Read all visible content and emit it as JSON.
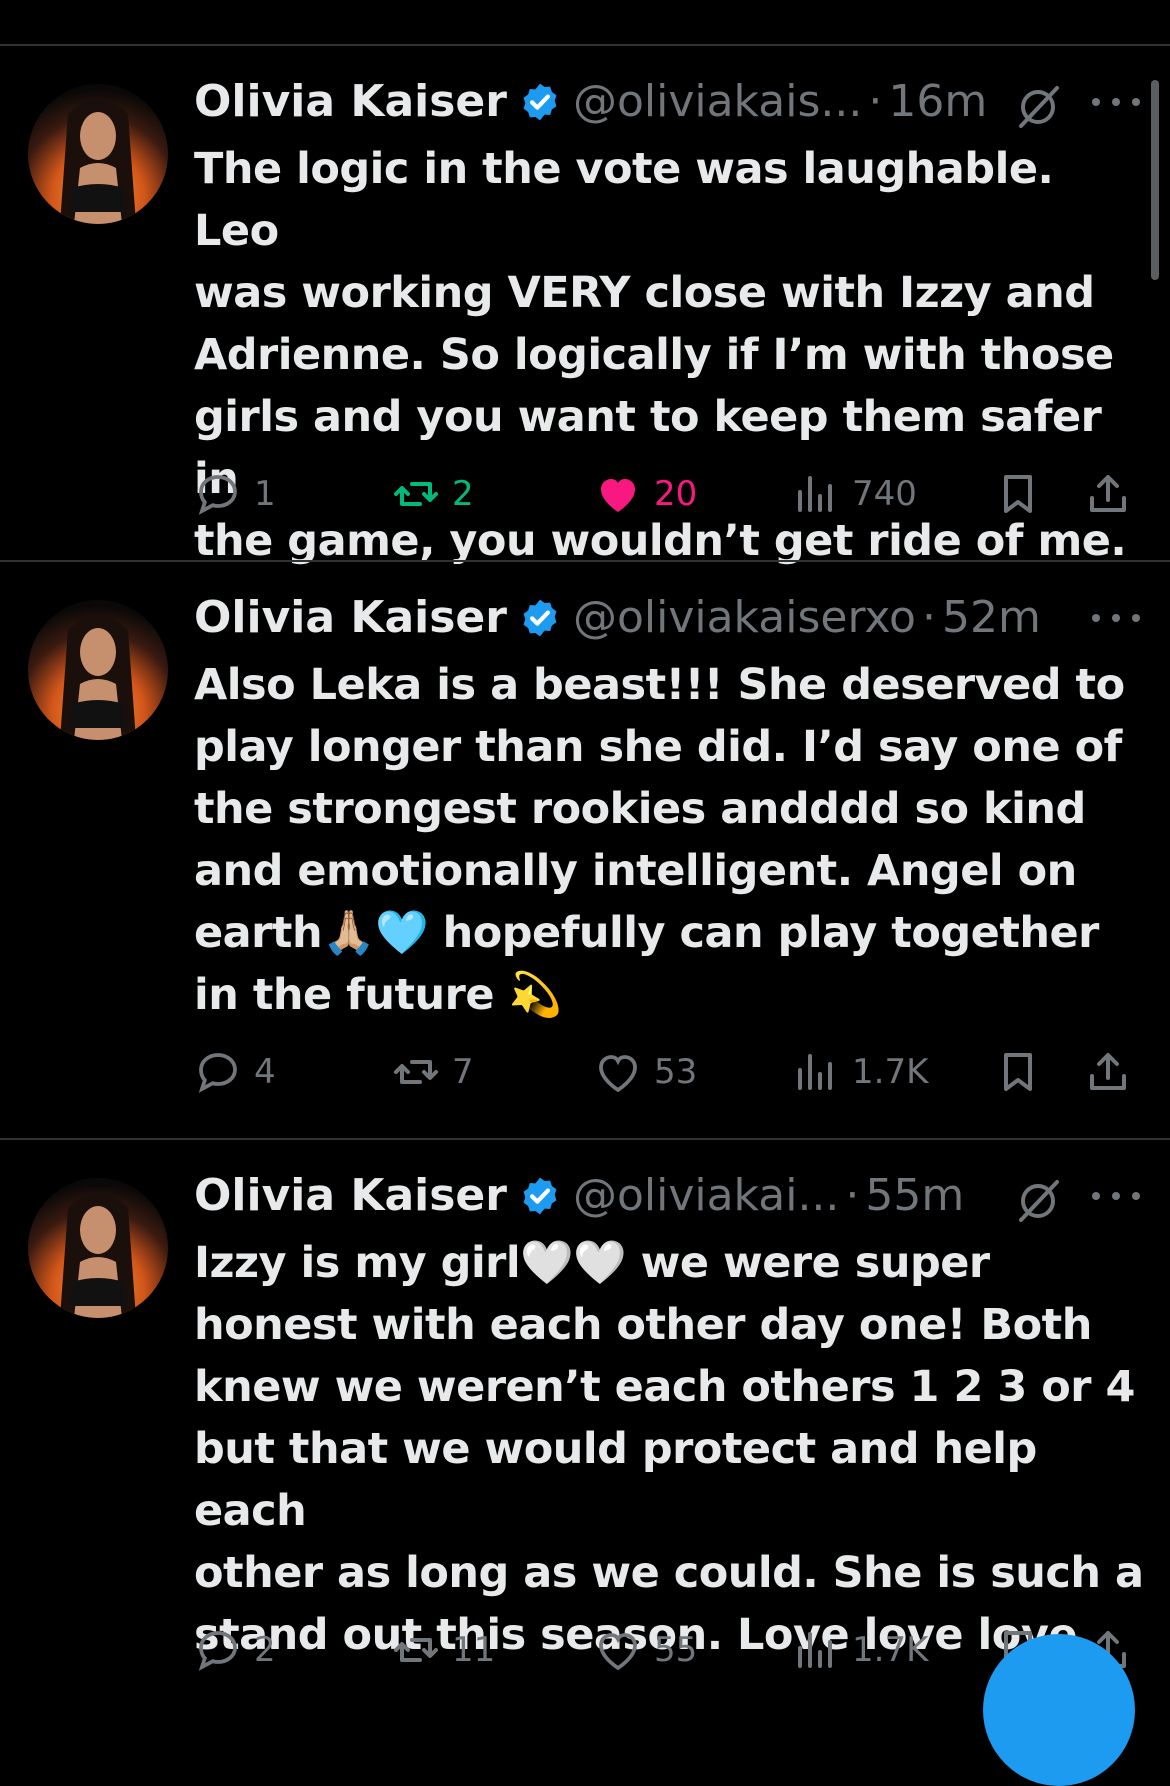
{
  "tweets": [
    {
      "name": "Olivia Kaiser",
      "handle": "@oliviakais...",
      "time": "16m",
      "text": "The logic in the vote was laughable. Leo\nwas working VERY close with Izzy and\nAdrienne. So logically if I’m with those\ngirls and you want to keep them safer in\nthe game, you wouldn’t get ride of me.",
      "replies": "1",
      "retweets": "2",
      "likes": "20",
      "views": "740",
      "retweeted": true,
      "liked": true
    },
    {
      "name": "Olivia Kaiser",
      "handle": "@oliviakaiserxo",
      "time": "52m",
      "text": "Also Leka is a beast!!! She deserved to\nplay longer than she did. I’d say one of\nthe strongest rookies andddd so kind\nand emotionally intelligent. Angel on\nearth🙏🏼🩵 hopefully can play together\nin the future 💫",
      "replies": "4",
      "retweets": "7",
      "likes": "53",
      "views": "1.7K",
      "retweeted": false,
      "liked": false
    },
    {
      "name": "Olivia Kaiser",
      "handle": "@oliviakai...",
      "time": "55m",
      "text": "Izzy is my girl🤍🤍 we were super\nhonest with each other day one! Both\nknew we weren’t each others 1 2 3 or 4\nbut that we would protect and help each\nother as long as we could. She is such a\nstand out this season. Love love love",
      "replies": "2",
      "retweets": "11",
      "likes": "55",
      "views": "1.7K",
      "retweeted": false,
      "liked": false
    }
  ],
  "separator": "·",
  "icons": {
    "verified": "verified-badge-icon",
    "grok": "grok-icon",
    "more": "more-icon",
    "reply": "reply-icon",
    "retweet": "retweet-icon",
    "like": "heart-icon",
    "views": "views-icon",
    "bookmark": "bookmark-icon",
    "share": "share-icon"
  },
  "colors": {
    "background": "#000000",
    "text": "#e7e9ea",
    "secondary": "#71767b",
    "verified": "#1d9bf0",
    "retweet_active": "#00ba7c",
    "like_active": "#f91880"
  }
}
